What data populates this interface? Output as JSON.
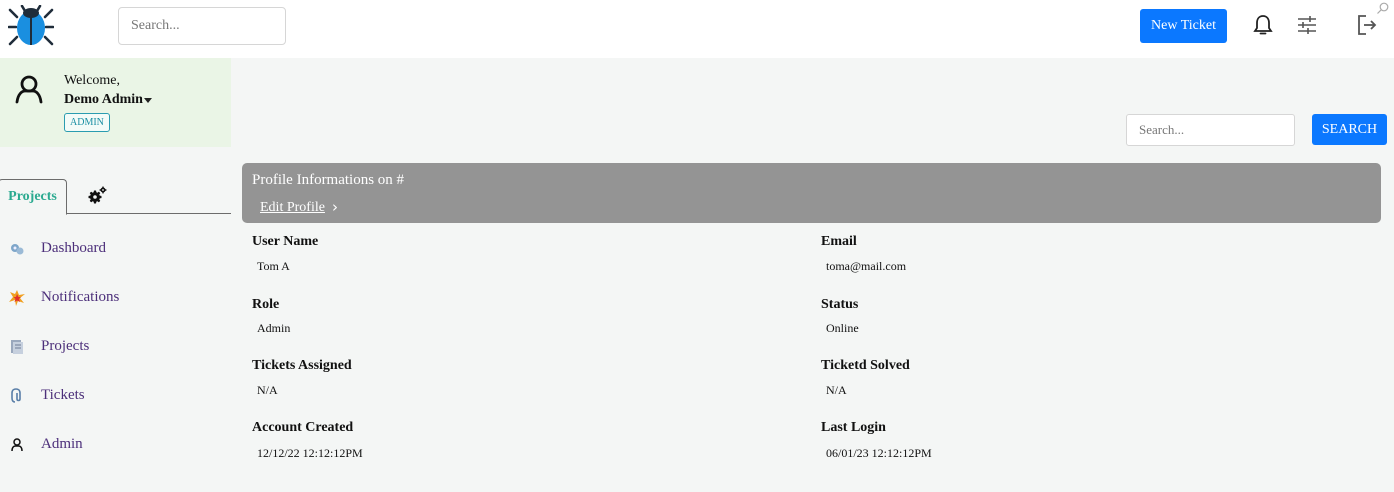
{
  "topbar": {
    "search_placeholder": "Search...",
    "new_ticket_label": "New Ticket",
    "accent_color": "#0b78ff"
  },
  "welcome": {
    "greeting": "Welcome,",
    "name": "Demo Admin",
    "role_badge": "ADMIN",
    "panel_color": "#eaf5e6"
  },
  "tabs": {
    "projects_label": "Projects",
    "settings_icon": "gears-icon"
  },
  "sidebar": {
    "items": [
      {
        "label": "Dashboard",
        "icon": "dashboard-icon"
      },
      {
        "label": "Notifications",
        "icon": "notifications-icon"
      },
      {
        "label": "Projects",
        "icon": "projects-icon"
      },
      {
        "label": "Tickets",
        "icon": "tickets-icon"
      },
      {
        "label": "Admin",
        "icon": "admin-icon"
      }
    ]
  },
  "search": {
    "placeholder": "Search...",
    "button_label": "SEARCH"
  },
  "profile": {
    "title": "Profile Informations on #",
    "edit_link": "Edit Profile",
    "fields": [
      {
        "label": "User Name",
        "value": "Tom A"
      },
      {
        "label": "Email",
        "value": "toma@mail.com"
      },
      {
        "label": "Role",
        "value": "Admin"
      },
      {
        "label": "Status",
        "value": "Online"
      },
      {
        "label": "Tickets Assigned",
        "value": "N/A"
      },
      {
        "label": "Ticketd Solved",
        "value": "N/A"
      },
      {
        "label": "Account Created",
        "value": "12/12/22 12:12:12PM"
      },
      {
        "label": "Last Login",
        "value": "06/01/23 12:12:12PM"
      }
    ]
  }
}
